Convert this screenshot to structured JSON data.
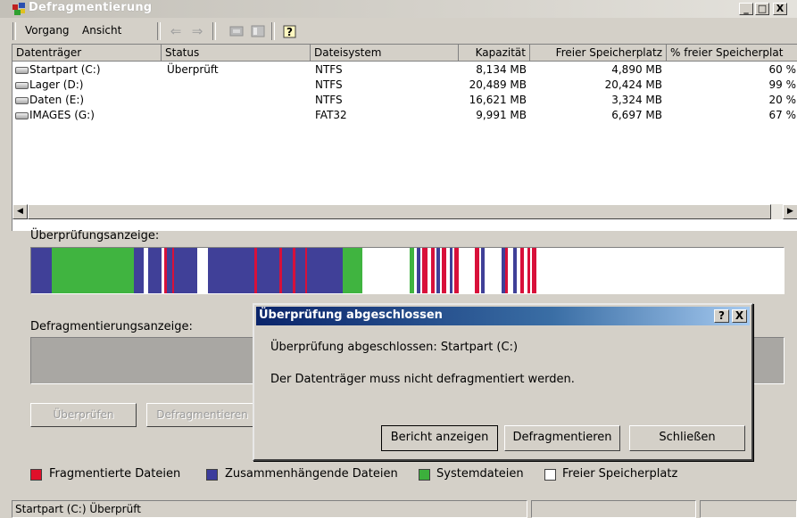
{
  "window": {
    "title": "Defragmentierung",
    "icon": "defrag-app-icon",
    "caption_buttons": [
      "_",
      "□",
      "X"
    ]
  },
  "menu": {
    "items": [
      {
        "label": "Vorgang",
        "underline": "o"
      },
      {
        "label": "Ansicht",
        "underline": "A"
      }
    ],
    "toolbar_icons": [
      "back-arrow-icon",
      "forward-arrow-icon",
      "drive-properties-icon",
      "view-icon",
      "help-icon"
    ]
  },
  "volumes": {
    "columns": [
      "Datenträger",
      "Status",
      "Dateisystem",
      "Kapazität",
      "Freier Speicherplatz",
      "% freier Speicherplat"
    ],
    "rows": [
      {
        "name": "Startpart (C:)",
        "status": "Überprüft",
        "fs": "NTFS",
        "capacity": "8,134 MB",
        "free": "4,890 MB",
        "pct": "60 %"
      },
      {
        "name": "Lager (D:)",
        "status": "",
        "fs": "NTFS",
        "capacity": "20,489 MB",
        "free": "20,424 MB",
        "pct": "99 %"
      },
      {
        "name": "Daten (E:)",
        "status": "",
        "fs": "NTFS",
        "capacity": "16,621 MB",
        "free": "3,324 MB",
        "pct": "20 %"
      },
      {
        "name": "IMAGES (G:)",
        "status": "",
        "fs": "FAT32",
        "capacity": "9,991 MB",
        "free": "6,697 MB",
        "pct": "67 %"
      }
    ]
  },
  "analysis": {
    "label": "Überprüfungsanzeige:",
    "segments": [
      {
        "from": 0.0,
        "to": 0.027,
        "kind": "contiguous"
      },
      {
        "from": 0.027,
        "to": 0.033,
        "kind": "system"
      },
      {
        "from": 0.033,
        "to": 0.137,
        "kind": "system"
      },
      {
        "from": 0.137,
        "to": 0.15,
        "kind": "contiguous"
      },
      {
        "from": 0.15,
        "to": 0.155,
        "kind": "free"
      },
      {
        "from": 0.155,
        "to": 0.173,
        "kind": "contiguous"
      },
      {
        "from": 0.177,
        "to": 0.18,
        "kind": "fragmented"
      },
      {
        "from": 0.18,
        "to": 0.188,
        "kind": "contiguous"
      },
      {
        "from": 0.188,
        "to": 0.19,
        "kind": "fragmented"
      },
      {
        "from": 0.19,
        "to": 0.221,
        "kind": "contiguous"
      },
      {
        "from": 0.235,
        "to": 0.297,
        "kind": "contiguous"
      },
      {
        "from": 0.297,
        "to": 0.3,
        "kind": "fragmented"
      },
      {
        "from": 0.3,
        "to": 0.33,
        "kind": "contiguous"
      },
      {
        "from": 0.33,
        "to": 0.333,
        "kind": "fragmented"
      },
      {
        "from": 0.333,
        "to": 0.348,
        "kind": "contiguous"
      },
      {
        "from": 0.348,
        "to": 0.351,
        "kind": "fragmented"
      },
      {
        "from": 0.351,
        "to": 0.364,
        "kind": "contiguous"
      },
      {
        "from": 0.364,
        "to": 0.367,
        "kind": "fragmented"
      },
      {
        "from": 0.367,
        "to": 0.414,
        "kind": "contiguous"
      },
      {
        "from": 0.414,
        "to": 0.44,
        "kind": "system"
      },
      {
        "from": 0.503,
        "to": 0.509,
        "kind": "system"
      },
      {
        "from": 0.512,
        "to": 0.517,
        "kind": "contiguous"
      },
      {
        "from": 0.52,
        "to": 0.527,
        "kind": "fragmented"
      },
      {
        "from": 0.531,
        "to": 0.536,
        "kind": "fragmented"
      },
      {
        "from": 0.539,
        "to": 0.543,
        "kind": "contiguous"
      },
      {
        "from": 0.546,
        "to": 0.552,
        "kind": "fragmented"
      },
      {
        "from": 0.556,
        "to": 0.56,
        "kind": "contiguous"
      },
      {
        "from": 0.562,
        "to": 0.568,
        "kind": "fragmented"
      },
      {
        "from": 0.59,
        "to": 0.595,
        "kind": "fragmented"
      },
      {
        "from": 0.598,
        "to": 0.603,
        "kind": "contiguous"
      },
      {
        "from": 0.625,
        "to": 0.63,
        "kind": "contiguous"
      },
      {
        "from": 0.63,
        "to": 0.633,
        "kind": "fragmented"
      },
      {
        "from": 0.64,
        "to": 0.645,
        "kind": "contiguous"
      },
      {
        "from": 0.65,
        "to": 0.655,
        "kind": "fragmented"
      },
      {
        "from": 0.66,
        "to": 0.663,
        "kind": "fragmented"
      },
      {
        "from": 0.666,
        "to": 0.671,
        "kind": "fragmented"
      }
    ]
  },
  "defrag": {
    "label": "Defragmentierungsanzeige:"
  },
  "buttons": {
    "analyze": "Überprüfen",
    "defragment": "Defragmentieren"
  },
  "legend": [
    {
      "label": "Fragmentierte Dateien",
      "color": "#e0102a"
    },
    {
      "label": "Zusammenhängende Dateien",
      "color": "#3c3c9c"
    },
    {
      "label": "Systemdateien",
      "color": "#3cb03c"
    },
    {
      "label": "Freier Speicherplatz",
      "color": "#ffffff"
    }
  ],
  "colors": {
    "fragmented": "#d8103a",
    "contiguous": "#404098",
    "system": "#40b440",
    "free": "#ffffff"
  },
  "status_bar": {
    "text": "Startpart (C:) Überprüft"
  },
  "dialog": {
    "title": "Überprüfung abgeschlossen",
    "line1": "Überprüfung abgeschlossen: Startpart (C:)",
    "line2": "Der Datenträger muss nicht defragmentiert werden.",
    "buttons": {
      "report": "Bericht anzeigen",
      "defragment": "Defragmentieren",
      "close": "Schließen"
    },
    "help": "?",
    "close": "X"
  }
}
